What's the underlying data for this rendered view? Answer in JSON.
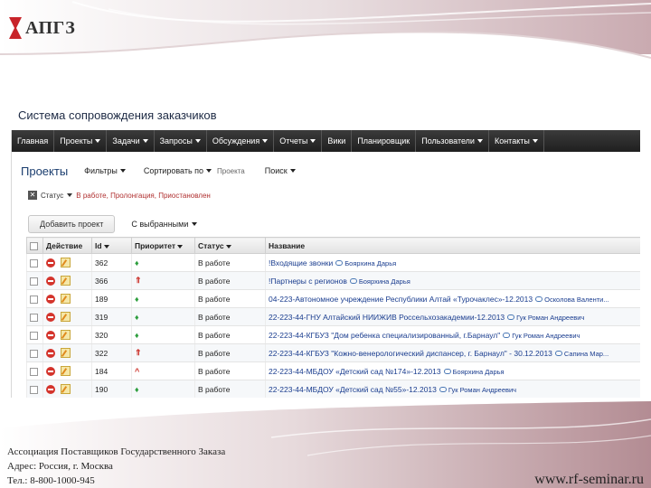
{
  "logo": {
    "text": "АПГЗ"
  },
  "system_title": "Система сопровождения заказчиков",
  "menu": [
    {
      "label": "Главная",
      "dropdown": false
    },
    {
      "label": "Проекты",
      "dropdown": true
    },
    {
      "label": "Задачи",
      "dropdown": true
    },
    {
      "label": "Запросы",
      "dropdown": true
    },
    {
      "label": "Обсуждения",
      "dropdown": true
    },
    {
      "label": "Отчеты",
      "dropdown": true
    },
    {
      "label": "Вики",
      "dropdown": false
    },
    {
      "label": "Планировщик",
      "dropdown": false
    },
    {
      "label": "Пользователи",
      "dropdown": true
    },
    {
      "label": "Контакты",
      "dropdown": true
    }
  ],
  "toolbar": {
    "page_title": "Проекты",
    "filters": "Фильтры",
    "sort": "Сортировать по",
    "sort_value": "Проекта",
    "search": "Поиск"
  },
  "status_filter": {
    "key": "Статус",
    "values": "В работе, Пролонгация, Приостановлен"
  },
  "actions": {
    "add_project": "Добавить проект",
    "selected": "С выбранными"
  },
  "table": {
    "headers": [
      "",
      "Действие",
      "Id",
      "Приоритет",
      "Статус",
      "Название"
    ],
    "rows": [
      {
        "id": "362",
        "priority": "low",
        "priority_glyph": "♦",
        "status": "В работе",
        "name": "!Входящие звонки",
        "owner": "Боярхина Дарья"
      },
      {
        "id": "366",
        "priority": "high",
        "priority_glyph": "⇑",
        "status": "В работе",
        "name": "!Партнеры с регионов",
        "owner": "Боярхина Дарья"
      },
      {
        "id": "189",
        "priority": "low",
        "priority_glyph": "♦",
        "status": "В работе",
        "name": "04-223-Автономное учреждение Республики Алтай «Турочаклес»-12.2013",
        "owner": "Осколова Валенти..."
      },
      {
        "id": "319",
        "priority": "low",
        "priority_glyph": "♦",
        "status": "В работе",
        "name": "22-223-44-ГНУ Алтайский НИИЖИВ Россельхозакадемии-12.2013",
        "owner": "Гук Роман Андреевич"
      },
      {
        "id": "320",
        "priority": "low",
        "priority_glyph": "♦",
        "status": "В работе",
        "name": "22-223-44-КГБУЗ \"Дом ребенка специализированный, г.Барнаул\"",
        "owner": "Гук Роман Андреевич"
      },
      {
        "id": "322",
        "priority": "high",
        "priority_glyph": "⇑",
        "status": "В работе",
        "name": "22-223-44-КГБУЗ \"Кожно-венерологический диспансер, г. Барнаул\" - 30.12.2013",
        "owner": "Сапина Мар..."
      },
      {
        "id": "184",
        "priority": "high",
        "priority_glyph": "^",
        "status": "В работе",
        "name": "22-223-44-МБДОУ «Детский сад №174»-12.2013",
        "owner": "Боярхина Дарья"
      },
      {
        "id": "190",
        "priority": "low",
        "priority_glyph": "♦",
        "status": "В работе",
        "name": "22-223-44-МБДОУ «Детский сад №55»-12.2013",
        "owner": "Гук Роман Андреевич"
      }
    ]
  },
  "footer": {
    "line1": "Ассоциация Поставщиков Государственного Заказа",
    "line2": "Адрес: Россия, г. Москва",
    "line3": "Тел.: 8-800-1000-945",
    "site": "www.rf-seminar.ru"
  },
  "colors": {
    "accent_red": "#c8242a",
    "menubar": "#2a2a2a",
    "link_blue": "#1a3d8f",
    "footer_mauve": "#b9959c"
  }
}
